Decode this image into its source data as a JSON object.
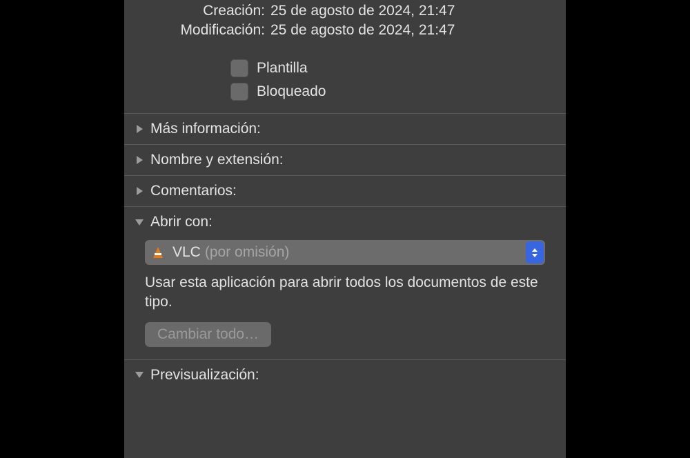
{
  "info": {
    "creation_label": "Creación:",
    "creation_value": "25 de agosto de 2024, 21:47",
    "modification_label": "Modificación:",
    "modification_value": "25 de agosto de 2024, 21:47"
  },
  "checkboxes": {
    "template_label": "Plantilla",
    "template_checked": false,
    "locked_label": "Bloqueado",
    "locked_checked": false
  },
  "sections": {
    "more_info": {
      "title": "Más información:",
      "expanded": false
    },
    "name_ext": {
      "title": "Nombre y extensión:",
      "expanded": false
    },
    "comments": {
      "title": "Comentarios:",
      "expanded": false
    },
    "open_with": {
      "title": "Abrir con:",
      "expanded": true,
      "app_name": "VLC",
      "app_hint": "(por omisión)",
      "help_text": "Usar esta aplicación para abrir todos los documentos de este tipo.",
      "change_all_label": "Cambiar todo…"
    },
    "preview": {
      "title": "Previsualización:",
      "expanded": true
    }
  }
}
